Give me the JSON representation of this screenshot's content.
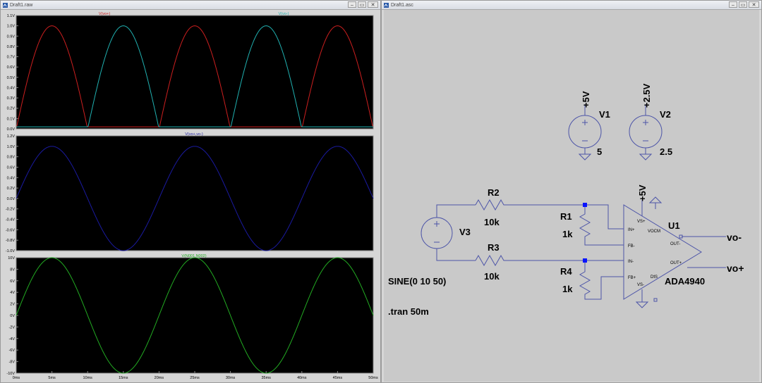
{
  "waveform_window": {
    "title": "Draft1.raw",
    "buttons": {
      "minimize": "–",
      "restore": "▭",
      "close": "✕"
    }
  },
  "schematic_window": {
    "title": "Draft1.asc",
    "buttons": {
      "minimize": "–",
      "restore": "▭",
      "close": "✕"
    }
  },
  "colors": {
    "vout_plus": "#cc1f1f",
    "vout_minus": "#20b0b0",
    "vout_diff": "#1a1aa0",
    "vin_diff": "#22aa22",
    "wire": "#4d55a8",
    "plot_bg": "#000000",
    "schematic_bg": "#c9c9c9"
  },
  "chart_data": [
    {
      "type": "line",
      "title": "",
      "series": [
        {
          "name": "V(vo+)",
          "x": [
            0,
            5,
            10,
            15,
            20,
            25,
            30,
            35,
            40,
            45,
            50
          ],
          "values": [
            0.02,
            1.0,
            0.02,
            0.02,
            0.02,
            1.0,
            0.02,
            0.02,
            0.02,
            1.0,
            0.02
          ]
        },
        {
          "name": "V(vo-)",
          "x": [
            0,
            5,
            10,
            15,
            20,
            25,
            30,
            35,
            40,
            45,
            50
          ],
          "values": [
            0.02,
            0.02,
            0.02,
            1.0,
            0.02,
            0.02,
            0.02,
            1.0,
            0.02,
            0.02,
            0.02
          ]
        }
      ],
      "ylim": [
        0.0,
        1.1
      ],
      "yticks": [
        "1.1V",
        "1.0V",
        "0.9V",
        "0.8V",
        "0.7V",
        "0.6V",
        "0.5V",
        "0.4V",
        "0.3V",
        "0.2V",
        "0.1V",
        "0.0V"
      ],
      "grid": false
    },
    {
      "type": "line",
      "series": [
        {
          "name": "V(vo+,vo-)",
          "x": [
            0,
            5,
            10,
            15,
            20,
            25,
            30,
            35,
            40,
            45,
            50
          ],
          "values": [
            0,
            1.0,
            0,
            -1.0,
            0,
            1.0,
            0,
            -1.0,
            0,
            1.0,
            0
          ]
        }
      ],
      "ylim": [
        -1.0,
        1.2
      ],
      "yticks": [
        "1.2V",
        "1.0V",
        "0.8V",
        "0.6V",
        "0.4V",
        "0.2V",
        "0.0V",
        "-0.2V",
        "-0.4V",
        "-0.6V",
        "-0.8V",
        "-1.0V"
      ],
      "grid": false
    },
    {
      "type": "line",
      "series": [
        {
          "name": "V(N001,N002)",
          "x": [
            0,
            5,
            10,
            15,
            20,
            25,
            30,
            35,
            40,
            45,
            50
          ],
          "values": [
            0,
            10,
            0,
            -10,
            0,
            10,
            0,
            -10,
            0,
            10,
            0
          ]
        }
      ],
      "ylim": [
        -10,
        10
      ],
      "yticks": [
        "10V",
        "8V",
        "6V",
        "4V",
        "2V",
        "0V",
        "-2V",
        "-4V",
        "-6V",
        "-8V",
        "-10V"
      ],
      "xlim": [
        0,
        50
      ],
      "xticks": [
        "0ms",
        "5ms",
        "10ms",
        "15ms",
        "20ms",
        "25ms",
        "30ms",
        "35ms",
        "40ms",
        "45ms",
        "50ms"
      ],
      "grid": false
    }
  ],
  "schematic": {
    "v1": {
      "name": "V1",
      "value": "5",
      "net": "+5V"
    },
    "v2": {
      "name": "V2",
      "value": "2.5",
      "net": "+2.5V"
    },
    "v3": {
      "name": "V3",
      "value": "SINE(0 10 50)"
    },
    "r1": {
      "name": "R1",
      "value": "1k"
    },
    "r2": {
      "name": "R2",
      "value": "10k"
    },
    "r3": {
      "name": "R3",
      "value": "10k"
    },
    "r4": {
      "name": "R4",
      "value": "1k"
    },
    "u1": {
      "name": "U1",
      "part": "ADA4940",
      "supply": "+5V",
      "pins": {
        "vsp": "VS+",
        "inp": "IN+",
        "fbm": "FB-",
        "inm": "IN-",
        "fbp": "FB+",
        "vsm": "VS-",
        "vocm": "VOCM",
        "outm": "OUT-",
        "outp": "OUT+",
        "dis": "DIS"
      }
    },
    "nets": {
      "vo_minus": "vo-",
      "vo_plus": "vo+"
    },
    "directive": ".tran 50m"
  }
}
